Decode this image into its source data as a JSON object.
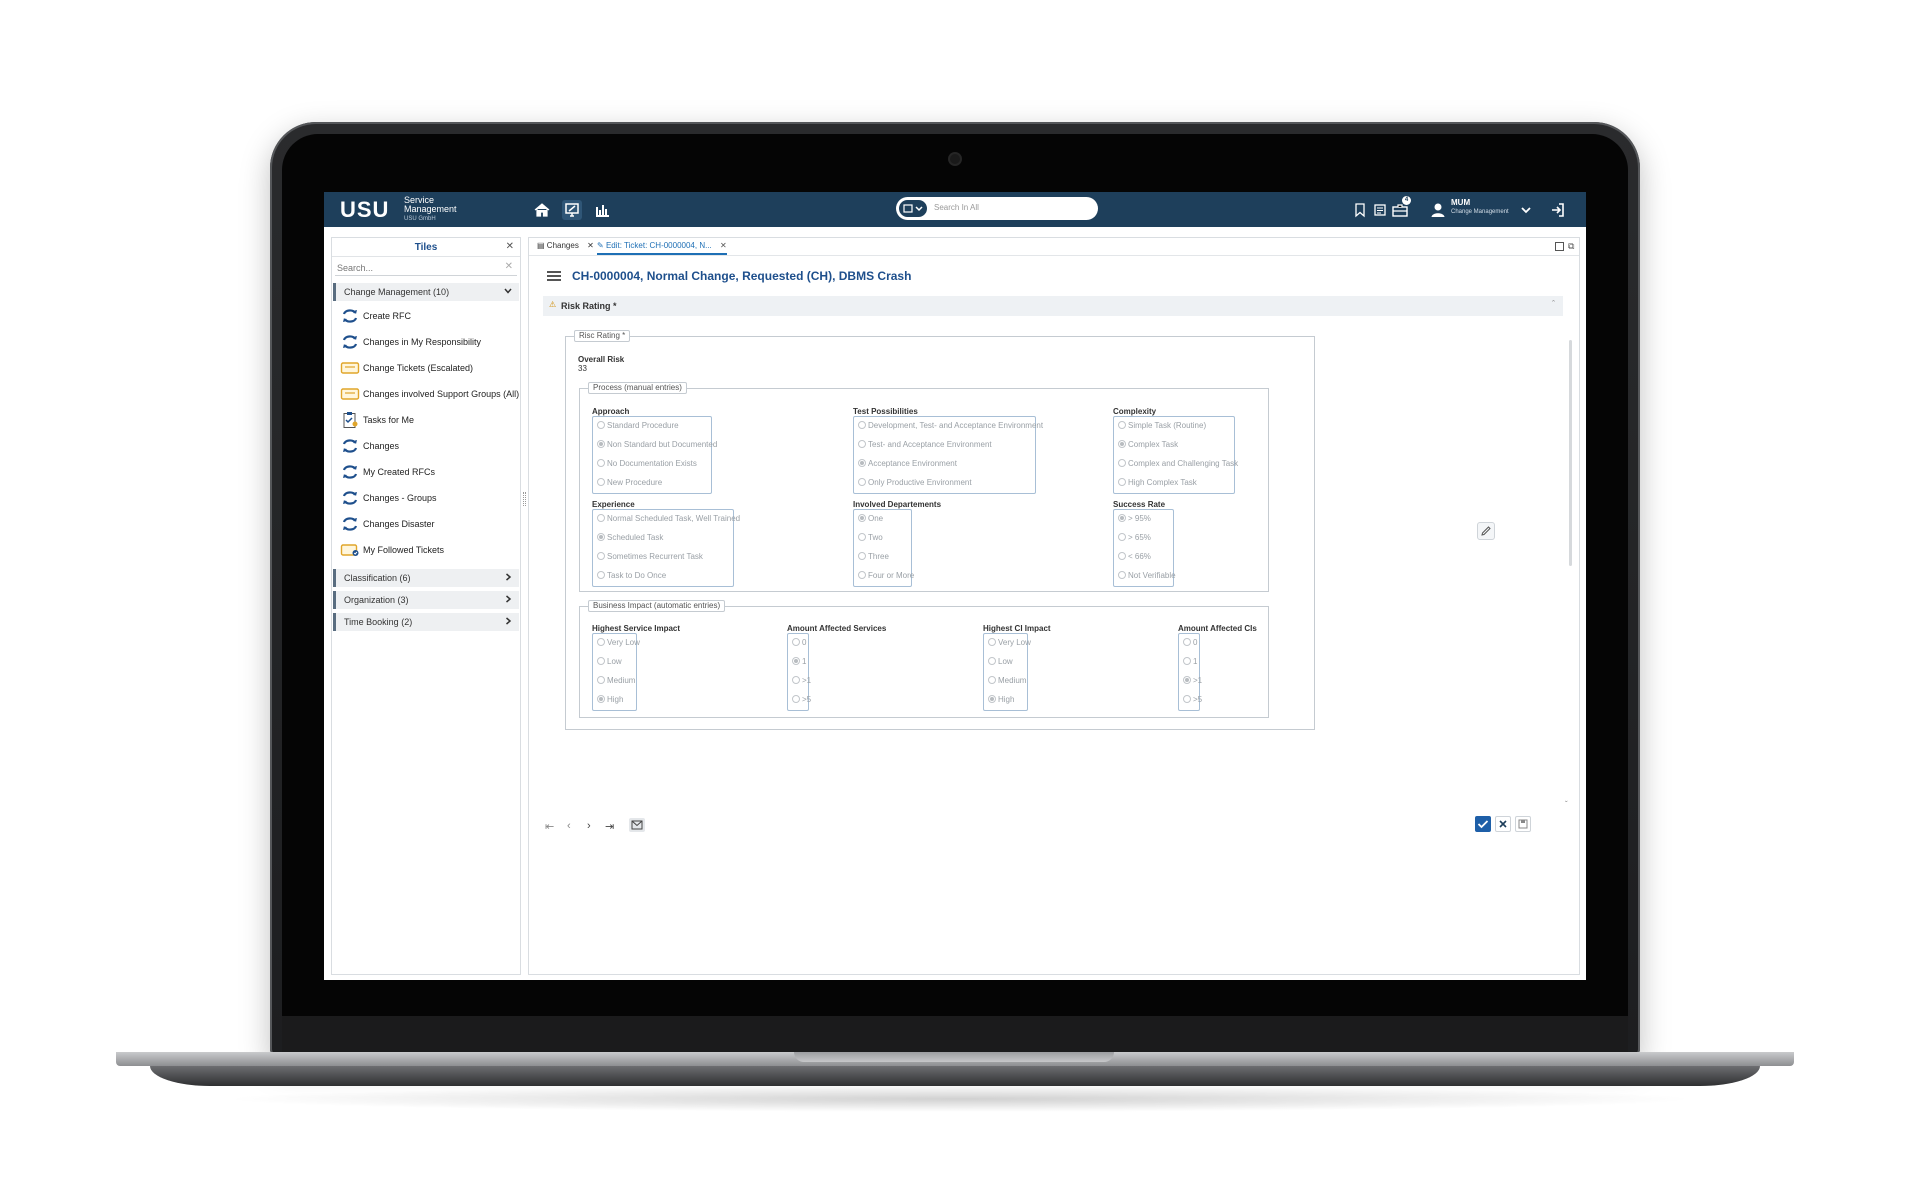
{
  "app": {
    "logo": "USU",
    "brand_line1": "Service",
    "brand_line2": "Management",
    "brand_line3": "USU GmbH",
    "search_placeholder": "Search In All",
    "notification_count": "4",
    "user_name": "MUM",
    "user_role": "Change Management"
  },
  "tiles": {
    "title": "Tiles",
    "search_placeholder": "Search...",
    "groups": [
      {
        "label": "Change Management (10)"
      },
      {
        "label": "Classification (6)"
      },
      {
        "label": "Organization (3)"
      },
      {
        "label": "Time Booking (2)"
      }
    ],
    "items": [
      {
        "label": "Create RFC",
        "icon": "change-arrows-icon"
      },
      {
        "label": "Changes in My Responsibility",
        "icon": "change-arrows-icon"
      },
      {
        "label": "Change Tickets (Escalated)",
        "icon": "ticket-icon"
      },
      {
        "label": "Changes involved Support Groups (All)",
        "icon": "ticket-icon"
      },
      {
        "label": "Tasks for Me",
        "icon": "clipboard-task-icon"
      },
      {
        "label": "Changes",
        "icon": "change-arrows-icon"
      },
      {
        "label": "My Created RFCs",
        "icon": "change-arrows-icon"
      },
      {
        "label": "Changes - Groups",
        "icon": "change-arrows-icon"
      },
      {
        "label": "Changes Disaster",
        "icon": "change-arrows-icon"
      },
      {
        "label": "My Followed Tickets",
        "icon": "followed-ticket-icon"
      }
    ]
  },
  "tabs": [
    {
      "label": "Changes"
    },
    {
      "label": "Edit: Ticket: CH-0000004, N..."
    }
  ],
  "ticket": {
    "title": "CH-0000004, Normal Change, Requested (CH), DBMS Crash",
    "section": "Risk Rating *",
    "risc_legend": "Risc Rating *",
    "overall_label": "Overall Risk",
    "overall_value": "33"
  },
  "process": {
    "legend": "Process (manual entries)",
    "groups": [
      {
        "label": "Approach",
        "options": [
          "Standard Procedure",
          "Non Standard but Documented",
          "No Documentation Exists",
          "New Procedure"
        ],
        "selected": 1
      },
      {
        "label": "Test Possibilities",
        "options": [
          "Development, Test- and Acceptance Environment",
          "Test- and Acceptance Environment",
          "Acceptance Environment",
          "Only Productive Environment"
        ],
        "selected": 2
      },
      {
        "label": "Complexity",
        "options": [
          "Simple Task (Routine)",
          "Complex Task",
          "Complex and Challenging  Task",
          "High Complex Task"
        ],
        "selected": 1
      },
      {
        "label": "Experience",
        "options": [
          "Normal Scheduled Task, Well Trained",
          "Scheduled Task",
          "Sometimes Recurrent Task",
          "Task to Do Once"
        ],
        "selected": 1
      },
      {
        "label": "Involved Departements",
        "options": [
          "One",
          "Two",
          "Three",
          "Four or More"
        ],
        "selected": 0
      },
      {
        "label": "Success Rate",
        "options": [
          "> 95%",
          "> 65%",
          "< 66%",
          "Not Verifiable"
        ],
        "selected": 0
      }
    ]
  },
  "business": {
    "legend": "Business Impact (automatic entries)",
    "groups": [
      {
        "label": "Highest Service Impact",
        "options": [
          "Very Low",
          "Low",
          "Medium",
          "High"
        ],
        "selected": 3
      },
      {
        "label": "Amount Affected Services",
        "options": [
          "0",
          "1",
          ">1",
          ">5"
        ],
        "selected": 1
      },
      {
        "label": "Highest CI Impact",
        "options": [
          "Very Low",
          "Low",
          "Medium",
          "High"
        ],
        "selected": 3
      },
      {
        "label": "Amount Affected CIs",
        "options": [
          "0",
          "1",
          ">1",
          ">5"
        ],
        "selected": 2
      }
    ]
  }
}
